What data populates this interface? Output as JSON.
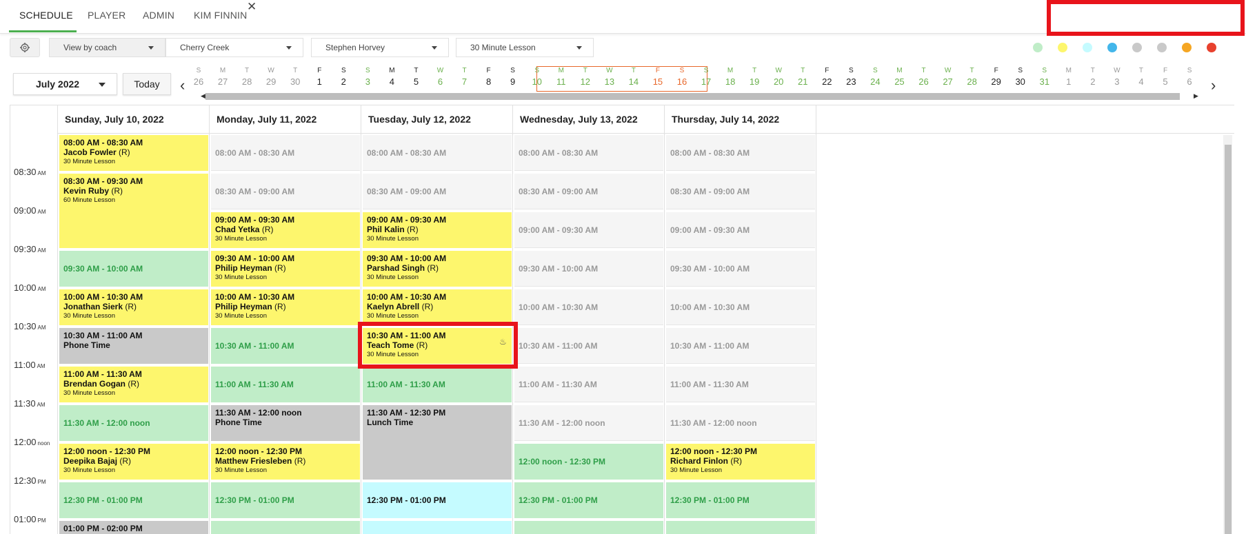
{
  "topnav": {
    "tabs": [
      {
        "label": "SCHEDULE",
        "active": true
      },
      {
        "label": "PLAYER",
        "active": false
      },
      {
        "label": "ADMIN",
        "active": false
      },
      {
        "label": "KIM FINNIN",
        "active": false
      }
    ],
    "close_glyph": "✕"
  },
  "toolbar": {
    "view_by": "View by coach",
    "location": "Cherry Creek",
    "coach": "Stephen Horvey",
    "lesson_type": "30 Minute Lesson",
    "legend_colors": [
      "#c0edc8",
      "#fdf66d",
      "#c5fbff",
      "#43b6ea",
      "#c9c9c9",
      "#c9c9c9",
      "#f5a623",
      "#e8412e"
    ]
  },
  "datebar": {
    "month": "July 2022",
    "today_label": "Today",
    "days": [
      {
        "l": "S",
        "n": "26",
        "c": "gray"
      },
      {
        "l": "M",
        "n": "27",
        "c": "gray"
      },
      {
        "l": "T",
        "n": "28",
        "c": "gray"
      },
      {
        "l": "W",
        "n": "29",
        "c": "gray"
      },
      {
        "l": "T",
        "n": "30",
        "c": "gray"
      },
      {
        "l": "F",
        "n": "1",
        "c": "black"
      },
      {
        "l": "S",
        "n": "2",
        "c": "black"
      },
      {
        "l": "S",
        "n": "3",
        "c": "green"
      },
      {
        "l": "M",
        "n": "4",
        "c": "black"
      },
      {
        "l": "T",
        "n": "5",
        "c": "black"
      },
      {
        "l": "W",
        "n": "6",
        "c": "green"
      },
      {
        "l": "T",
        "n": "7",
        "c": "green"
      },
      {
        "l": "F",
        "n": "8",
        "c": "black"
      },
      {
        "l": "S",
        "n": "9",
        "c": "black"
      },
      {
        "l": "S",
        "n": "10",
        "c": "green"
      },
      {
        "l": "M",
        "n": "11",
        "c": "green"
      },
      {
        "l": "T",
        "n": "12",
        "c": "green"
      },
      {
        "l": "W",
        "n": "13",
        "c": "green"
      },
      {
        "l": "T",
        "n": "14",
        "c": "green"
      },
      {
        "l": "F",
        "n": "15",
        "c": "red"
      },
      {
        "l": "S",
        "n": "16",
        "c": "red"
      },
      {
        "l": "S",
        "n": "17",
        "c": "green"
      },
      {
        "l": "M",
        "n": "18",
        "c": "green"
      },
      {
        "l": "T",
        "n": "19",
        "c": "green"
      },
      {
        "l": "W",
        "n": "20",
        "c": "green"
      },
      {
        "l": "T",
        "n": "21",
        "c": "green"
      },
      {
        "l": "F",
        "n": "22",
        "c": "black"
      },
      {
        "l": "S",
        "n": "23",
        "c": "black"
      },
      {
        "l": "S",
        "n": "24",
        "c": "green"
      },
      {
        "l": "M",
        "n": "25",
        "c": "green"
      },
      {
        "l": "T",
        "n": "26",
        "c": "green"
      },
      {
        "l": "W",
        "n": "27",
        "c": "green"
      },
      {
        "l": "T",
        "n": "28",
        "c": "green"
      },
      {
        "l": "F",
        "n": "29",
        "c": "black"
      },
      {
        "l": "S",
        "n": "30",
        "c": "black"
      },
      {
        "l": "S",
        "n": "31",
        "c": "green"
      },
      {
        "l": "M",
        "n": "1",
        "c": "gray"
      },
      {
        "l": "T",
        "n": "2",
        "c": "gray"
      },
      {
        "l": "W",
        "n": "3",
        "c": "gray"
      },
      {
        "l": "T",
        "n": "4",
        "c": "gray"
      },
      {
        "l": "F",
        "n": "5",
        "c": "gray"
      },
      {
        "l": "S",
        "n": "6",
        "c": "gray"
      }
    ]
  },
  "calendar": {
    "columns": [
      "Sunday, July 10, 2022",
      "Monday, July 11, 2022",
      "Tuesday, July 12, 2022",
      "Wednesday, July 13, 2022",
      "Thursday, July 14, 2022"
    ],
    "times": [
      {
        "t": "08:30",
        "ap": "AM"
      },
      {
        "t": "09:00",
        "ap": "AM"
      },
      {
        "t": "09:30",
        "ap": "AM"
      },
      {
        "t": "10:00",
        "ap": "AM"
      },
      {
        "t": "10:30",
        "ap": "AM"
      },
      {
        "t": "11:00",
        "ap": "AM"
      },
      {
        "t": "11:30",
        "ap": "AM"
      },
      {
        "t": "12:00",
        "ap": "noon"
      },
      {
        "t": "12:30",
        "ap": "PM"
      },
      {
        "t": "01:00",
        "ap": "PM"
      }
    ],
    "slots": {
      "sun": [
        {
          "row": 0,
          "span": 1,
          "kind": "booked",
          "time": "08:00 AM - 08:30 AM",
          "name": "Jacob Fowler",
          "rec": "(R)",
          "type": "30 Minute Lesson"
        },
        {
          "row": 1,
          "span": 2,
          "kind": "booked",
          "time": "08:30 AM - 09:30 AM",
          "name": "Kevin Ruby",
          "rec": "(R)",
          "type": "60 Minute Lesson"
        },
        {
          "row": 3,
          "span": 1,
          "kind": "avail",
          "time": "09:30 AM - 10:00 AM"
        },
        {
          "row": 4,
          "span": 1,
          "kind": "booked",
          "time": "10:00 AM - 10:30 AM",
          "name": "Jonathan Sierk",
          "rec": "(R)",
          "type": "30 Minute Lesson"
        },
        {
          "row": 5,
          "span": 1,
          "kind": "gray",
          "time": "10:30 AM - 11:00 AM",
          "name": "Phone Time"
        },
        {
          "row": 6,
          "span": 1,
          "kind": "booked",
          "time": "11:00 AM - 11:30 AM",
          "name": "Brendan Gogan",
          "rec": "(R)",
          "type": "30 Minute Lesson"
        },
        {
          "row": 7,
          "span": 1,
          "kind": "avail",
          "time": "11:30 AM - 12:00 noon"
        },
        {
          "row": 8,
          "span": 1,
          "kind": "booked",
          "time": "12:00 noon - 12:30 PM",
          "name": "Deepika Bajaj",
          "rec": "(R)",
          "type": "30 Minute Lesson"
        },
        {
          "row": 9,
          "span": 1,
          "kind": "avail",
          "time": "12:30 PM - 01:00 PM"
        },
        {
          "row": 10,
          "span": 1,
          "kind": "gray",
          "time": "01:00 PM - 02:00 PM"
        }
      ],
      "mon": [
        {
          "row": 0,
          "span": 1,
          "kind": "open",
          "time": "08:00 AM - 08:30 AM"
        },
        {
          "row": 1,
          "span": 1,
          "kind": "open",
          "time": "08:30 AM - 09:00 AM"
        },
        {
          "row": 2,
          "span": 1,
          "kind": "booked",
          "time": "09:00 AM - 09:30 AM",
          "name": "Chad Yetka",
          "rec": "(R)",
          "type": "30 Minute Lesson"
        },
        {
          "row": 3,
          "span": 1,
          "kind": "booked",
          "time": "09:30 AM - 10:00 AM",
          "name": "Philip Heyman",
          "rec": "(R)",
          "type": "30 Minute Lesson"
        },
        {
          "row": 4,
          "span": 1,
          "kind": "booked",
          "time": "10:00 AM - 10:30 AM",
          "name": "Philip Heyman",
          "rec": "(R)",
          "type": "30 Minute Lesson"
        },
        {
          "row": 5,
          "span": 1,
          "kind": "avail",
          "time": "10:30 AM - 11:00 AM"
        },
        {
          "row": 6,
          "span": 1,
          "kind": "avail",
          "time": "11:00 AM - 11:30 AM"
        },
        {
          "row": 7,
          "span": 1,
          "kind": "gray",
          "time": "11:30 AM - 12:00 noon",
          "name": "Phone Time"
        },
        {
          "row": 8,
          "span": 1,
          "kind": "booked",
          "time": "12:00 noon - 12:30 PM",
          "name": "Matthew Friesleben",
          "rec": "(R)",
          "type": "30 Minute Lesson"
        },
        {
          "row": 9,
          "span": 1,
          "kind": "avail",
          "time": "12:30 PM - 01:00 PM"
        },
        {
          "row": 10,
          "span": 1,
          "kind": "avail",
          "time": ""
        }
      ],
      "tue": [
        {
          "row": 0,
          "span": 1,
          "kind": "open",
          "time": "08:00 AM - 08:30 AM"
        },
        {
          "row": 1,
          "span": 1,
          "kind": "open",
          "time": "08:30 AM - 09:00 AM"
        },
        {
          "row": 2,
          "span": 1,
          "kind": "booked",
          "time": "09:00 AM - 09:30 AM",
          "name": "Phil Kalin",
          "rec": "(R)",
          "type": "30 Minute Lesson"
        },
        {
          "row": 3,
          "span": 1,
          "kind": "booked",
          "time": "09:30 AM - 10:00 AM",
          "name": "Parshad Singh",
          "rec": "(R)",
          "type": "30 Minute Lesson"
        },
        {
          "row": 4,
          "span": 1,
          "kind": "booked",
          "time": "10:00 AM - 10:30 AM",
          "name": "Kaelyn Abrell",
          "rec": "(R)",
          "type": "30 Minute Lesson"
        },
        {
          "row": 5,
          "span": 1,
          "kind": "booked",
          "time": "10:30 AM - 11:00 AM",
          "name": "Teach Tome",
          "rec": "(R)",
          "type": "30 Minute Lesson"
        },
        {
          "row": 6,
          "span": 1,
          "kind": "avail",
          "time": "11:00 AM - 11:30 AM"
        },
        {
          "row": 7,
          "span": 2,
          "kind": "gray",
          "time": "11:30 AM - 12:30 PM",
          "name": "Lunch Time"
        },
        {
          "row": 9,
          "span": 1,
          "kind": "cyan",
          "time": "12:30 PM - 01:00 PM"
        },
        {
          "row": 10,
          "span": 1,
          "kind": "cyan",
          "time": ""
        }
      ],
      "wed": [
        {
          "row": 0,
          "span": 1,
          "kind": "open",
          "time": "08:00 AM - 08:30 AM"
        },
        {
          "row": 1,
          "span": 1,
          "kind": "open",
          "time": "08:30 AM - 09:00 AM"
        },
        {
          "row": 2,
          "span": 1,
          "kind": "open",
          "time": "09:00 AM - 09:30 AM"
        },
        {
          "row": 3,
          "span": 1,
          "kind": "open",
          "time": "09:30 AM - 10:00 AM"
        },
        {
          "row": 4,
          "span": 1,
          "kind": "open",
          "time": "10:00 AM - 10:30 AM"
        },
        {
          "row": 5,
          "span": 1,
          "kind": "open",
          "time": "10:30 AM - 11:00 AM"
        },
        {
          "row": 6,
          "span": 1,
          "kind": "open",
          "time": "11:00 AM - 11:30 AM"
        },
        {
          "row": 7,
          "span": 1,
          "kind": "open",
          "time": "11:30 AM - 12:00 noon"
        },
        {
          "row": 8,
          "span": 1,
          "kind": "avail",
          "time": "12:00 noon - 12:30 PM"
        },
        {
          "row": 9,
          "span": 1,
          "kind": "avail",
          "time": "12:30 PM - 01:00 PM"
        },
        {
          "row": 10,
          "span": 1,
          "kind": "avail",
          "time": ""
        }
      ],
      "thu": [
        {
          "row": 0,
          "span": 1,
          "kind": "open",
          "time": "08:00 AM - 08:30 AM"
        },
        {
          "row": 1,
          "span": 1,
          "kind": "open",
          "time": "08:30 AM - 09:00 AM"
        },
        {
          "row": 2,
          "span": 1,
          "kind": "open",
          "time": "09:00 AM - 09:30 AM"
        },
        {
          "row": 3,
          "span": 1,
          "kind": "open",
          "time": "09:30 AM - 10:00 AM"
        },
        {
          "row": 4,
          "span": 1,
          "kind": "open",
          "time": "10:00 AM - 10:30 AM"
        },
        {
          "row": 5,
          "span": 1,
          "kind": "open",
          "time": "10:30 AM - 11:00 AM"
        },
        {
          "row": 6,
          "span": 1,
          "kind": "open",
          "time": "11:00 AM - 11:30 AM"
        },
        {
          "row": 7,
          "span": 1,
          "kind": "open",
          "time": "11:30 AM - 12:00 noon"
        },
        {
          "row": 8,
          "span": 1,
          "kind": "booked",
          "time": "12:00 noon - 12:30 PM",
          "name": "Richard Finlon",
          "rec": "(R)",
          "type": "30 Minute Lesson"
        },
        {
          "row": 9,
          "span": 1,
          "kind": "avail",
          "time": "12:30 PM - 01:00 PM"
        },
        {
          "row": 10,
          "span": 1,
          "kind": "avail",
          "time": ""
        }
      ]
    }
  }
}
